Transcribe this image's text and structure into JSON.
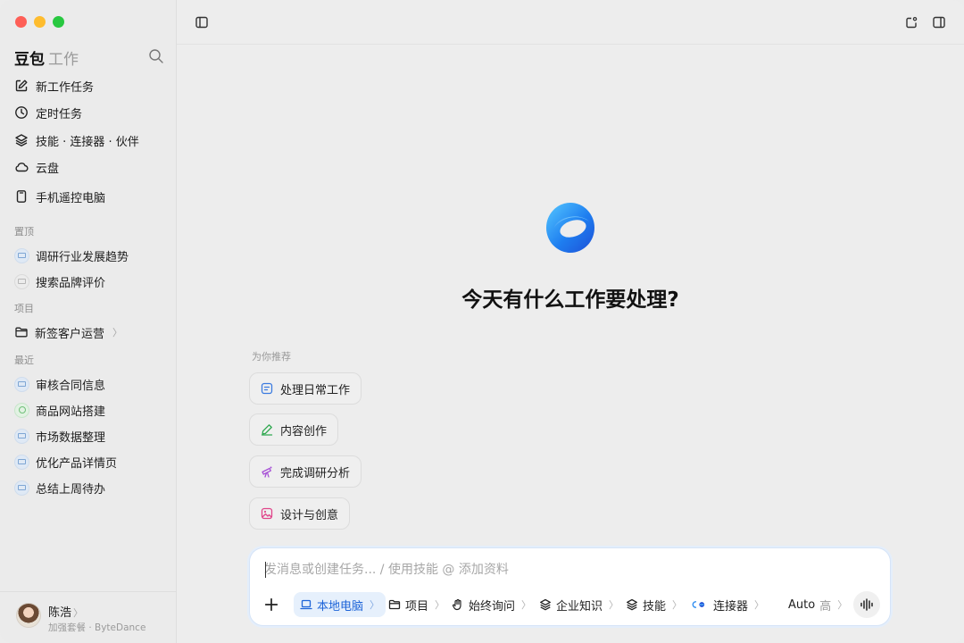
{
  "sidebar": {
    "brand": {
      "name": "豆包",
      "sub": "工作"
    },
    "nav": [
      {
        "label": "新工作任务",
        "icon": "edit-icon"
      },
      {
        "label": "定时任务",
        "icon": "clock-icon"
      },
      {
        "label": "技能 · 连接器 · 伙伴",
        "icon": "layers-icon"
      },
      {
        "label": "云盘",
        "icon": "cloud-icon"
      },
      {
        "label": "手机遥控电脑",
        "icon": "phone-icon"
      }
    ],
    "pinned_label": "置顶",
    "pinned": [
      "调研行业发展趋势",
      "搜索品牌评价"
    ],
    "projects_label": "项目",
    "projects": [
      {
        "label": "新签客户运营",
        "chevron": "〉"
      }
    ],
    "recent_label": "最近",
    "recent": [
      "审核合同信息",
      "商品网站搭建",
      "市场数据整理",
      "优化产品详情页",
      "总结上周待办"
    ],
    "user": {
      "name": "陈浩",
      "chevron": "〉",
      "subtitle": "加强套餐 · ByteDance"
    }
  },
  "main": {
    "headline": "今天有什么工作要处理?",
    "recommend_label": "为你推荐",
    "recommendations": [
      {
        "label": "处理日常工作",
        "icon": "document-icon",
        "color": "#3b7be0"
      },
      {
        "label": "内容创作",
        "icon": "pen-icon",
        "color": "#2fa84f"
      },
      {
        "label": "完成调研分析",
        "icon": "telescope-icon",
        "color": "#a64fd6"
      },
      {
        "label": "设计与创意",
        "icon": "image-icon",
        "color": "#e0458a"
      }
    ],
    "composer": {
      "placeholder": "发消息或创建任务... / 使用技能 @ 添加资料",
      "tools": {
        "local": "本地电脑",
        "project": "项目",
        "ask": "始终询问",
        "knowledge": "企业知识",
        "skills": "技能",
        "connectors": "连接器",
        "model": "Auto",
        "model_level": "高",
        "chevron": "〉"
      }
    }
  },
  "colors": {
    "accent": "#1d64d8",
    "accent_bg": "#e6f0fc"
  }
}
